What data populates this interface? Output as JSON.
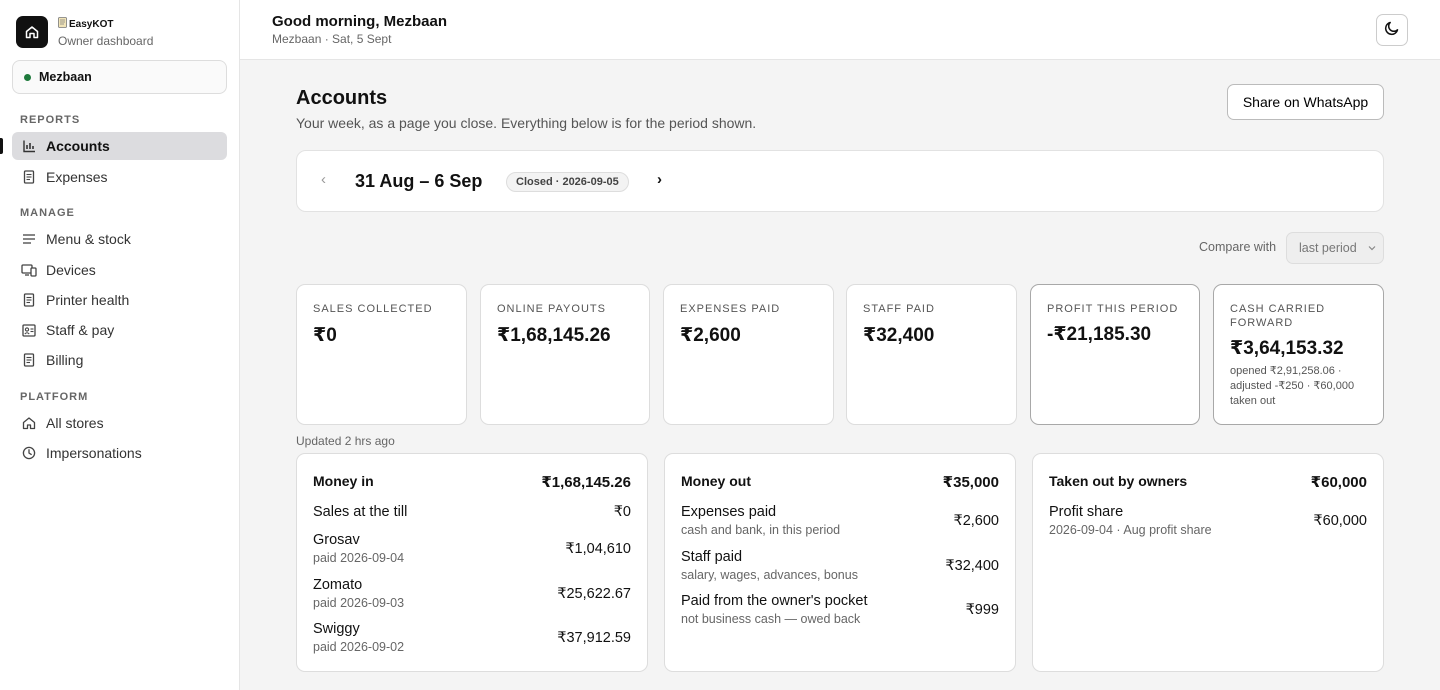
{
  "app": {
    "name": "EasyKOT",
    "subtitle": "Owner dashboard",
    "store": "Mezbaan"
  },
  "sidebar": {
    "reports_title": "REPORTS",
    "manage_title": "MANAGE",
    "platform_title": "PLATFORM",
    "reports": [
      {
        "label": "Accounts",
        "icon": "bar-chart-icon"
      },
      {
        "label": "Expenses",
        "icon": "receipt-icon"
      }
    ],
    "manage": [
      {
        "label": "Menu & stock",
        "icon": "list-icon"
      },
      {
        "label": "Devices",
        "icon": "devices-icon"
      },
      {
        "label": "Printer health",
        "icon": "receipt-icon"
      },
      {
        "label": "Staff & pay",
        "icon": "id-card-icon"
      },
      {
        "label": "Billing",
        "icon": "receipt-icon"
      }
    ],
    "platform": [
      {
        "label": "All stores",
        "icon": "home-icon"
      },
      {
        "label": "Impersonations",
        "icon": "clock-icon"
      }
    ]
  },
  "header": {
    "greeting": "Good morning, Mezbaan",
    "subline": "Mezbaan · Sat, 5 Sept"
  },
  "page": {
    "title": "Accounts",
    "subtitle": "Your week, as a page you close. Everything below is for the period shown.",
    "share_label": "Share on WhatsApp"
  },
  "period": {
    "prev": "‹",
    "next": "›",
    "range": "31 Aug – 6 Sep",
    "badge": "Closed · 2026-09-05"
  },
  "compare": {
    "label": "Compare with",
    "value": "last period"
  },
  "stats": [
    {
      "label": "SALES COLLECTED",
      "value": "₹0",
      "note": ""
    },
    {
      "label": "ONLINE PAYOUTS",
      "value": "₹1,68,145.26",
      "note": ""
    },
    {
      "label": "EXPENSES PAID",
      "value": "₹2,600",
      "note": ""
    },
    {
      "label": "STAFF PAID",
      "value": "₹32,400",
      "note": ""
    },
    {
      "label": "PROFIT THIS PERIOD",
      "value": "-₹21,185.30",
      "note": ""
    },
    {
      "label": "CASH CARRIED FORWARD",
      "value": "₹3,64,153.32",
      "note": "opened ₹2,91,258.06 · adjusted -₹250 · ₹60,000 taken out"
    }
  ],
  "updated": "Updated 2 hrs ago",
  "money_in": {
    "title": "Money in",
    "total": "₹1,68,145.26",
    "rows": [
      {
        "label": "Sales at the till",
        "sub": "",
        "value": "₹0"
      },
      {
        "label": "Grosav",
        "sub": "paid 2026-09-04",
        "value": "₹1,04,610"
      },
      {
        "label": "Zomato",
        "sub": "paid 2026-09-03",
        "value": "₹25,622.67"
      },
      {
        "label": "Swiggy",
        "sub": "paid 2026-09-02",
        "value": "₹37,912.59"
      }
    ]
  },
  "money_out": {
    "title": "Money out",
    "total": "₹35,000",
    "rows": [
      {
        "label": "Expenses paid",
        "sub": "cash and bank, in this period",
        "value": "₹2,600"
      },
      {
        "label": "Staff paid",
        "sub": "salary, wages, advances, bonus",
        "value": "₹32,400"
      },
      {
        "label": "Paid from the owner's pocket",
        "sub": "not business cash — owed back",
        "value": "₹999"
      }
    ]
  },
  "taken_out": {
    "title": "Taken out by owners",
    "total": "₹60,000",
    "rows": [
      {
        "label": "Profit share",
        "sub": "2026-09-04 · Aug profit share",
        "value": "₹60,000"
      }
    ]
  },
  "colors": {
    "accent": "#111111",
    "status_dot": "#1e7a3c",
    "active_nav": "#dcdcdf"
  }
}
